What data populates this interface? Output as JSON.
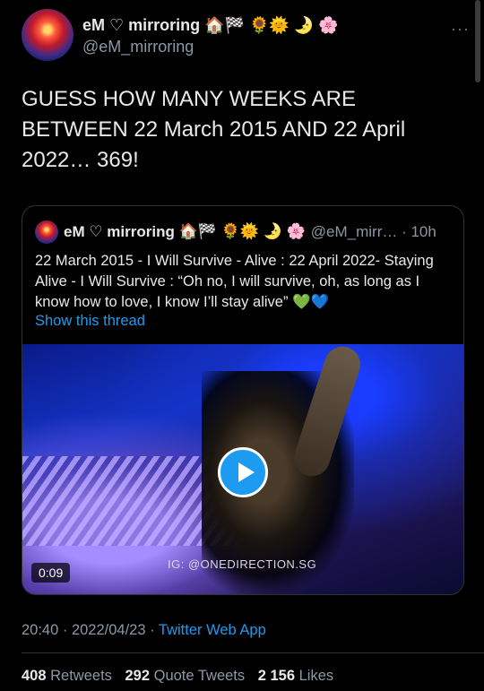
{
  "author": {
    "name": "eM ♡ mirroring",
    "emojis": "🏠🏁 🌻🌞 🌛 🌸",
    "handle": "@eM_mirroring"
  },
  "more_icon": "···",
  "tweet": {
    "text": "GUESS HOW MANY WEEKS ARE BETWEEN 22 March 2015 AND 22 April 2022… 369!"
  },
  "quote": {
    "name": "eM ♡ mirroring",
    "emojis": "🏠🏁 🌻🌞 🌛 🌸",
    "handle_time": "@eM_mirr… · 10h",
    "text": "22 March 2015 - I Will Survive - Alive : 22 April 2022- Staying Alive - I Will Survive : “Oh no, I will survive, oh, as long as I know how to love, I know I’ll stay alive” 💚💙",
    "show_thread": "Show this thread",
    "video": {
      "watermark": "IG: @ONEDIRECTION.SG",
      "duration": "0:09"
    }
  },
  "meta": {
    "time_date": "20:40 · 2022/04/23 · ",
    "app": "Twitter Web App"
  },
  "stats": {
    "retweets_count": "408",
    "retweets_label": "Retweets",
    "quotes_count": "292",
    "quotes_label": "Quote Tweets",
    "likes_count": "2 156",
    "likes_label": "Likes"
  }
}
